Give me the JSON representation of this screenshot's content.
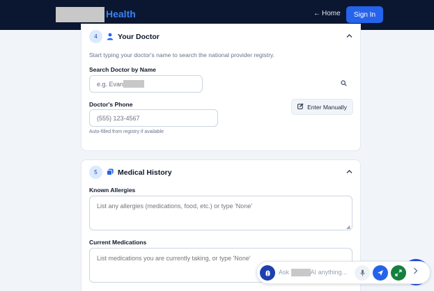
{
  "nav": {
    "brand": "Health",
    "home_link": "Home",
    "sign_in": "Sign In"
  },
  "doctor_section": {
    "step": "4",
    "title": "Your Doctor",
    "description": "Start typing your doctor's name to search the national provider registry.",
    "search_label": "Search Doctor by Name",
    "search_placeholder": "e.g. Evan",
    "phone_label": "Doctor's Phone",
    "phone_placeholder": "(555) 123-4567",
    "phone_hint": "Auto-filled from registry if available",
    "manual_button": "Enter Manually"
  },
  "history_section": {
    "step": "5",
    "title": "Medical History",
    "allergies_label": "Known Allergies",
    "allergies_placeholder": "List any allergies (medications, food, etc.) or type 'None'",
    "medications_label": "Current Medications",
    "medications_placeholder": "List medications you are currently taking, or type 'None'"
  },
  "ai_assistant": {
    "prefix": "Ask",
    "suffix": "AI anything..."
  },
  "icons": {
    "back": "arrow-left-icon",
    "doctor": "person-icon",
    "history": "records-icon",
    "collapse": "chevron-up-icon",
    "search": "search-icon",
    "edit": "edit-icon",
    "mic": "microphone-icon",
    "send": "send-icon",
    "expand": "expand-icon",
    "next": "chevron-right-icon"
  },
  "colors": {
    "navbar": "#0b1630",
    "brand": "#3b82f6",
    "primary": "#2563eb",
    "expand_button": "#15803d"
  }
}
